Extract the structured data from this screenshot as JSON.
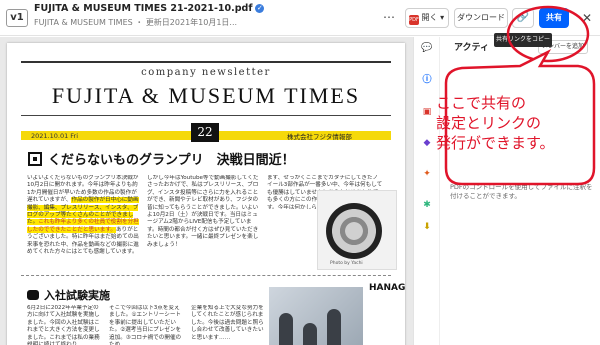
{
  "header": {
    "version": "v1",
    "file_title": "FUJITA & MUSEUM TIMES 21-2021-10.pdf",
    "file_subtitle": "FUJITA & MUSEUM TIMES ・ 更新日2021年10月1日...",
    "open_label": "開く",
    "download_label": "ダウンロード",
    "share_label": "共有",
    "more_icon": "more-dots-icon",
    "link_icon": "link-icon",
    "close_icon": "close-icon"
  },
  "tooltip": {
    "text": "共有リンクをコピー"
  },
  "newsletter": {
    "label": "company newsletter",
    "title": "FUJITA & MUSEUM TIMES",
    "date": "2021.10.01 Fri",
    "issue": "22",
    "publisher": "株式会社フジタ情報部",
    "headline": "くだらないものグランプリ　決戦日間近！",
    "col1_a": "いよいよくだらないものグランプリ本決戦が10月2日に開かれます。今年は昨年よりも約1か月開催日が早いため多数の作品の製作が遅れていますが、",
    "col1_highlight": "作品の製作が日中心に動画撮影、編集、プレスリリース、インスタ、ブログのアップ等たくさんのことができました。",
    "col1_red": "これも昨年より多くの社員で役割を分担したのでできたことだと思います。",
    "col1_b": "ありがとうございました。特に昨年はまだ始めての出来事を恐れた中、作品を動画などの撮影に進めてくれた方々にはとても感謝しています。",
    "col2": "しかし今年はYoutube等で動画撮影してくださったおかげで、私はプレスリリース、ブログ、インスタ投稿等にさらに力を入れることができ、新聞やテレビ取材があり、フジタの皆に知ってもらうことができました。いよいよ10月2日（土）が決戦日です。当日はミュージアム2階からLIVE配信も予定しています。時間の都合が付く方はぜひ見ていただきたいと思います。一緒に最終プレゼンを楽しみましょう！",
    "col3": "まず、せっかくここまでカタチにしてきたノイール3部作品が一番多い中、今年は何もしても優勝はしていません！あらかじめひとりでも多くの方にこの作品を見ていただきたいです。今年は何かしらの作品を……",
    "photo_credit": "Photo by Yachi",
    "section_heading": "入社試験実施",
    "col4": "6月2日に2022年卒業予定の方に向けて入社試験を実施しました。今回の入社試験はこれまでと大きく方法を変更しました。これまでは私の業務説明に続けて終わり……",
    "col5": "そこで今回は以下3点を変えました。①エントリーシートを事前に提出していただいた。②選考当日にプレゼンを追加。③コロナ禍での開催のため……",
    "col6": "企業を知る上で大変な努力をしてくれたことが感じられました。今後は過去問題と照らし合わせて改善していきたいと思います……",
    "vertical_text": "HANAGA"
  },
  "panel": {
    "activity_label": "アクティ",
    "add_label": "メンバーを追加",
    "note": "PDFのコントロールを使用してファイルに注釈を付けることができます。",
    "icons": [
      "comment-icon",
      "info-icon",
      "pdf-icon",
      "bell-icon",
      "star-icon",
      "slack-icon",
      "download-icon"
    ]
  },
  "callout": {
    "line1": "ここで共有の",
    "line2": "設定とリンクの",
    "line3": "発行ができます。",
    "color": "#e0142a"
  },
  "colors": {
    "brand_blue": "#0061fe",
    "highlight_yellow": "#f5d90a",
    "callout_red": "#e0142a"
  }
}
